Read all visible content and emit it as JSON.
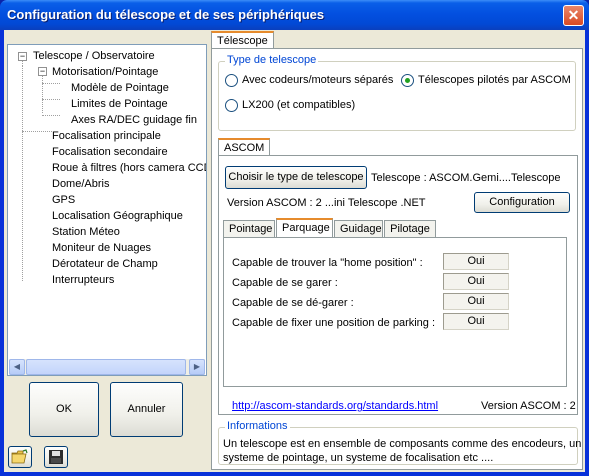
{
  "window": {
    "title": "Configuration du télescope et de ses périphériques",
    "close": "✕"
  },
  "tree": {
    "items": [
      {
        "label": "Telescope / Observatoire"
      },
      {
        "label": "Motorisation/Pointage"
      },
      {
        "label": "Modèle de Pointage"
      },
      {
        "label": "Limites de Pointage"
      },
      {
        "label": "Axes RA/DEC guidage fin"
      },
      {
        "label": "Focalisation principale"
      },
      {
        "label": "Focalisation secondaire"
      },
      {
        "label": "Roue à filtres (hors camera CCD)"
      },
      {
        "label": "Dome/Abris"
      },
      {
        "label": "GPS"
      },
      {
        "label": "Localisation Géographique"
      },
      {
        "label": "Station Méteo"
      },
      {
        "label": "Moniteur de Nuages"
      },
      {
        "label": "Dérotateur de Champ"
      },
      {
        "label": "Interrupteurs"
      }
    ],
    "expander_minus": "−"
  },
  "scroll": {
    "left": "◀",
    "right": "▶"
  },
  "buttons": {
    "ok": "OK",
    "annuler": "Annuler",
    "open_icon": "folder-open",
    "save_icon": "floppy-disk"
  },
  "main_tab": "Télescope",
  "type_group": {
    "title": "Type de telescope",
    "opt1": "Avec codeurs/moteurs séparés",
    "opt2": "Télescopes pilotés par ASCOM",
    "opt3": "LX200 (et compatibles)",
    "selected": "Télescopes pilotés par ASCOM"
  },
  "ascom": {
    "tab": "ASCOM",
    "choose_btn": "Choisir le type de telescope",
    "telescope_label": "Telescope : ASCOM.Gemi....Telescope",
    "version_label": "Version ASCOM : 2 ...ini Telescope .NET",
    "config_btn": "Configuration",
    "subtabs": [
      "Pointage",
      "Parquage",
      "Guidage",
      "Pilotage"
    ],
    "active_subtab": "Parquage",
    "rows": [
      {
        "label": "Capable de trouver la \"home position\" :",
        "value": "Oui"
      },
      {
        "label": "Capable de se garer :",
        "value": "Oui"
      },
      {
        "label": "Capable de se dé-garer :",
        "value": "Oui"
      },
      {
        "label": "Capable de fixer une position de parking :",
        "value": "Oui"
      }
    ],
    "link": "http://ascom-standards.org/standards.html",
    "version_footer": "Version ASCOM : 2"
  },
  "info": {
    "title": "Informations",
    "line1": "Un telescope est en ensemble de composants comme des encodeurs, un",
    "line2": "systeme de pointage, un systeme de focalisation etc ...."
  }
}
